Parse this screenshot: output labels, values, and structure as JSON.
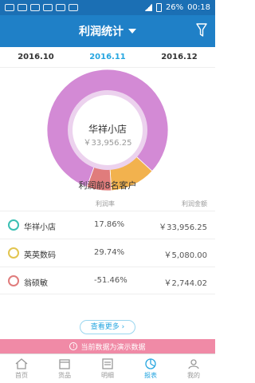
{
  "status_bar": {
    "battery": "26%",
    "time": "00:18"
  },
  "header": {
    "title": "利润统计"
  },
  "months": {
    "items": [
      "2016.10",
      "2016.11",
      "2016.12"
    ],
    "active_index": 1
  },
  "chart_data": {
    "type": "pie",
    "title": "",
    "slices": [
      {
        "label": "华祥小店",
        "value": 33956.25,
        "color": "#d38ad5"
      },
      {
        "label": "英英数码",
        "value": 5080.0,
        "color": "#f2b24e"
      },
      {
        "label": "翁硕敏",
        "value": -2744.02,
        "color": "#e07c7c"
      }
    ],
    "center": {
      "title": "华祥小店",
      "amount": "￥33,956.25"
    }
  },
  "caption": "利润前8名客户",
  "table": {
    "headers": [
      "利润率",
      "利润金额"
    ],
    "rows": [
      {
        "name": "华祥小店",
        "rate": "17.86%",
        "amount": "￥33,956.25",
        "color": "#3bbfb3"
      },
      {
        "name": "英英数码",
        "rate": "29.74%",
        "amount": "￥5,080.00",
        "color": "#e2c550"
      },
      {
        "name": "翁硕敏",
        "rate": "-51.46%",
        "amount": "￥2,744.02",
        "color": "#e07c7c"
      }
    ]
  },
  "more_label": "查看更多",
  "demo_notice": "当前数据为演示数据",
  "bottom_tabs": [
    "首页",
    "货品",
    "明细",
    "报表",
    "我的"
  ],
  "active_tab": 3
}
